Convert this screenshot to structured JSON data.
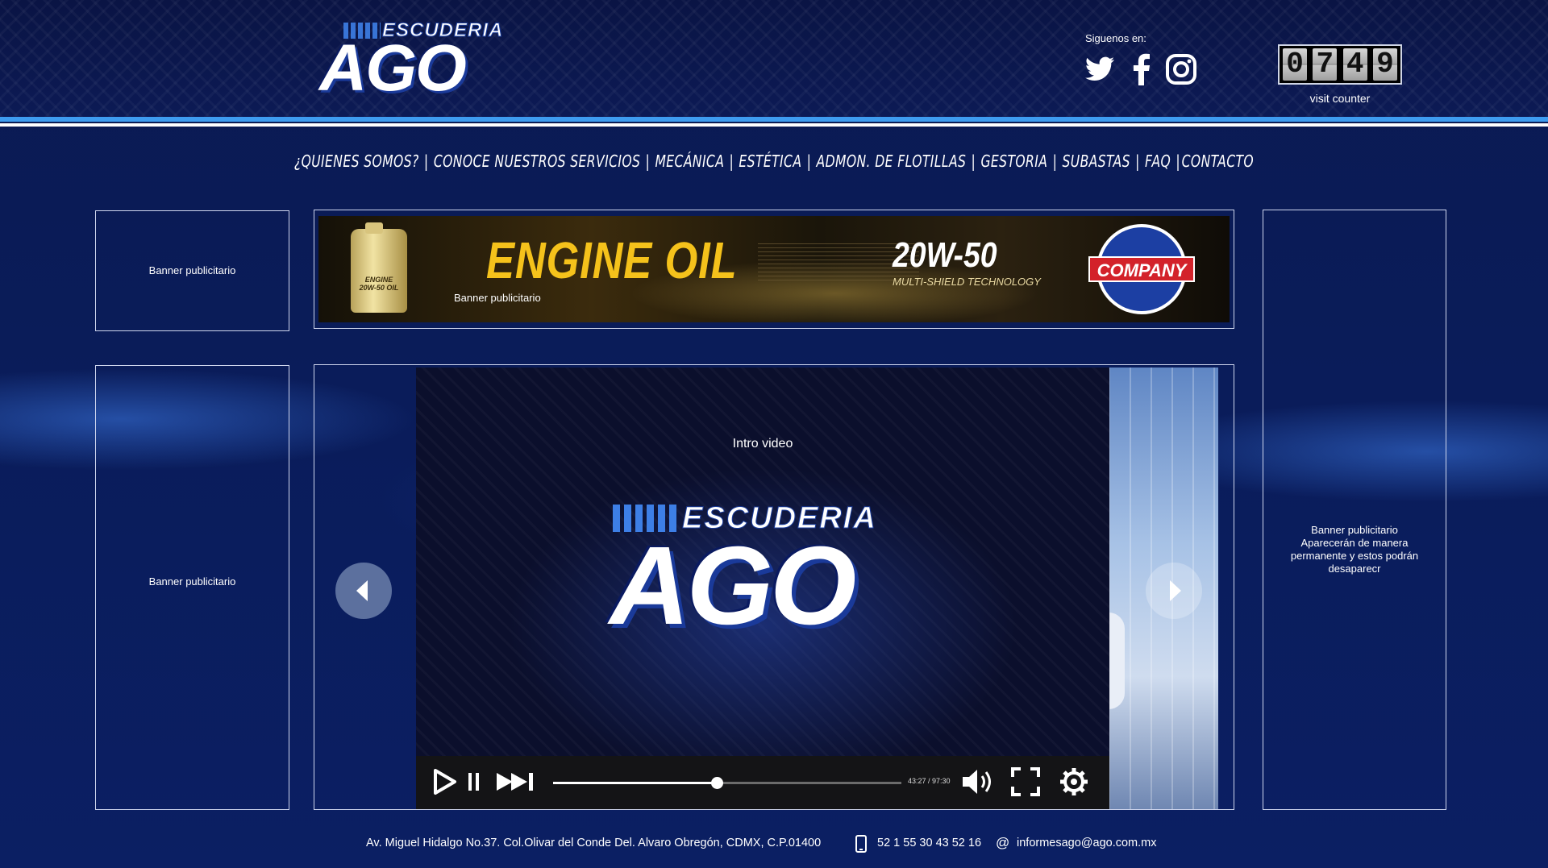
{
  "header": {
    "logo_top": "ESCUDERIA",
    "logo_main": "AGO",
    "follow_label": "Siguenos en:",
    "social_icons": [
      "twitter-icon",
      "facebook-icon",
      "instagram-icon"
    ],
    "counter_digits": [
      "0",
      "7",
      "4",
      "9"
    ],
    "counter_label": "visit counter"
  },
  "nav": {
    "items": [
      "¿QUIENES SOMOS?",
      "CONOCE NUESTROS SERVICIOS",
      "MECÁNICA",
      "ESTÉTICA",
      "ADMON. DE FLOTILLAS",
      "GESTORIA",
      "SUBASTAS",
      "FAQ",
      "CONTACTO"
    ],
    "separator": "|"
  },
  "banners": {
    "left_top": "Banner publicitario",
    "left_bottom": "Banner publicitario",
    "top_center": {
      "label": "Banner publicitario",
      "headline": "ENGINE OIL",
      "viscosity": "20W-50",
      "technology": "MULTI-SHIELD TECHNOLOGY",
      "company": "COMPANY",
      "bottle_label": "ENGINE 20W-50 OIL"
    },
    "right": {
      "line1": "Banner publicitario",
      "line2": "Aparecerán de manera permanente y estos podrán desaparecr"
    }
  },
  "video": {
    "title": "Intro video",
    "logo_top": "ESCUDERIA",
    "logo_main": "AGO",
    "time": "43:27 / 97:30",
    "progress": 0.47
  },
  "footer": {
    "address": "Av. Miguel Hidalgo No.37. Col.Olivar del Conde Del. Alvaro Obregón, CDMX, C.P.01400",
    "phone": "52 1 55 30 43 52 16",
    "email_symbol": "@",
    "email": "informesago@ago.com.mx"
  },
  "colors": {
    "background": "#0b1f63",
    "accent_stripe": "#3e9cf0",
    "border": "#cfd6ee",
    "ad_gold": "#f5c21b",
    "company_red": "#d3222a"
  }
}
